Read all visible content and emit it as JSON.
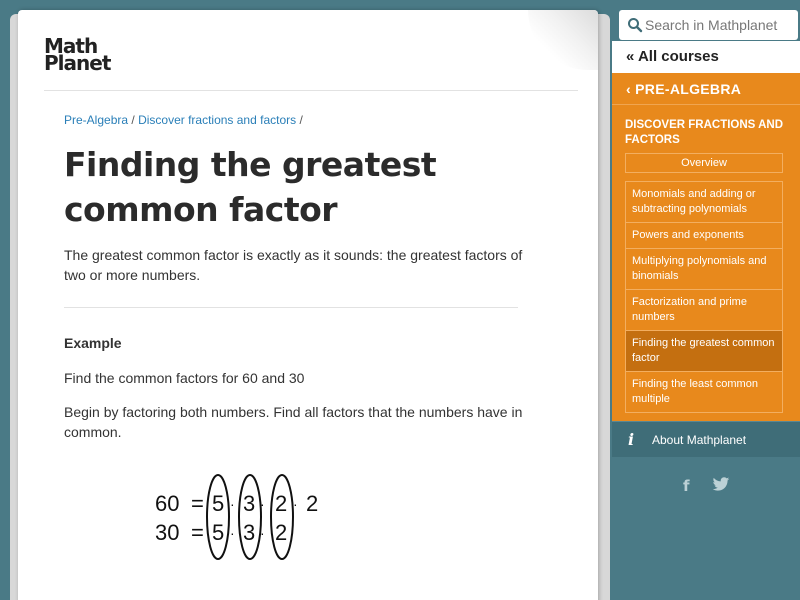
{
  "logo": {
    "line1": "Math",
    "line2": "Planet"
  },
  "breadcrumb": [
    {
      "label": "Pre-Algebra"
    },
    {
      "label": "Discover fractions and factors"
    }
  ],
  "breadcrumb_sep": "/",
  "page_title": "Finding the greatest common factor",
  "intro": "The greatest common factor is exactly as it sounds: the greatest factors of two or more numbers.",
  "example": {
    "title": "Example",
    "task": "Find the common factors for 60 and 30",
    "instruction": "Begin by factoring both numbers. Find all factors that the numbers have in common.",
    "row1": {
      "number": "60",
      "factors": [
        "5",
        "3",
        "2"
      ],
      "extra": "2"
    },
    "row2": {
      "number": "30",
      "factors": [
        "5",
        "3",
        "2"
      ]
    }
  },
  "sidebar": {
    "search_placeholder": "Search in Mathplanet",
    "all_courses": "All courses",
    "course": "PRE-ALGEBRA",
    "unit": "DISCOVER FRACTIONS AND FACTORS",
    "overview": "Overview",
    "lessons": [
      {
        "label": "Monomials and adding or subtracting polynomials",
        "active": false
      },
      {
        "label": "Powers and exponents",
        "active": false
      },
      {
        "label": "Multiplying polynomials and binomials",
        "active": false
      },
      {
        "label": "Factorization and prime numbers",
        "active": false
      },
      {
        "label": "Finding the greatest common factor",
        "active": true
      },
      {
        "label": "Finding the least common multiple",
        "active": false
      }
    ],
    "about": "About Mathplanet",
    "icons": {
      "about": "info-icon",
      "facebook": "facebook-icon",
      "twitter": "twitter-icon"
    }
  },
  "colors": {
    "accent": "#e8891c",
    "active_lesson": "#c46f10",
    "teal": "#4a7a86",
    "link": "#2a7fb8"
  }
}
